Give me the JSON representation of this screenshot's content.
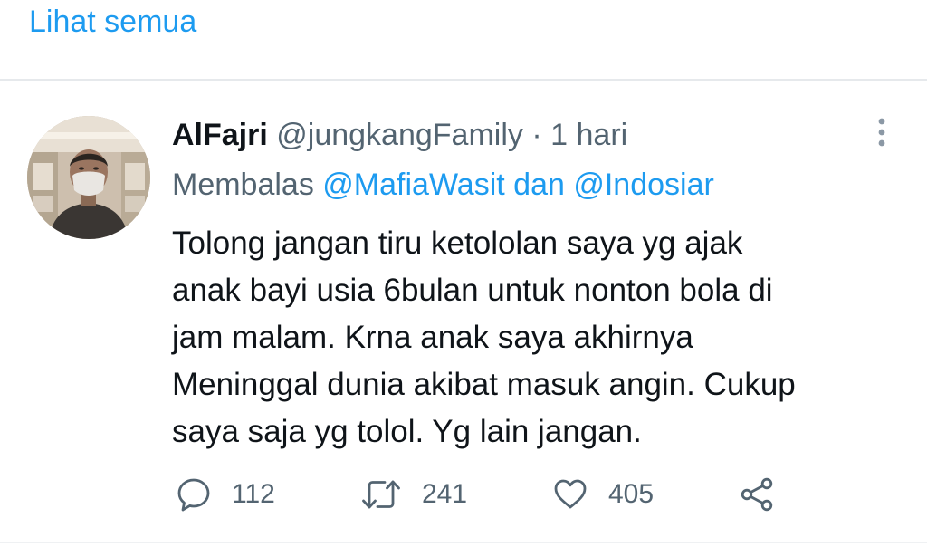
{
  "see_all": {
    "label": "Lihat semua"
  },
  "tweet": {
    "name": "AlFajri",
    "handle": "@jungkangFamily",
    "separator": "·",
    "time": "1 hari",
    "reply": {
      "prefix": "Membalas",
      "mention1": "@MafiaWasit",
      "conjunction": "dan",
      "mention2": "@Indosiar"
    },
    "text_lines": [
      "Tolong jangan tiru ketololan saya yg ajak",
      "anak bayi usia 6bulan untuk nonton bola di",
      "jam malam. Krna anak saya akhirnya",
      "Meninggal dunia akibat masuk angin. Cukup",
      "saya saja yg tolol. Yg lain jangan."
    ],
    "actions": {
      "replies": {
        "icon": "reply-icon",
        "count": "112"
      },
      "retweets": {
        "icon": "retweet-icon",
        "count": "241"
      },
      "likes": {
        "icon": "heart-icon",
        "count": "405"
      },
      "share": {
        "icon": "share-icon"
      }
    },
    "more_icon": "more-vertical-icon"
  },
  "colors": {
    "link": "#1d9bf0",
    "secondary_text": "#536471",
    "primary_text": "#0f1419",
    "divider": "#e6e9ec"
  }
}
